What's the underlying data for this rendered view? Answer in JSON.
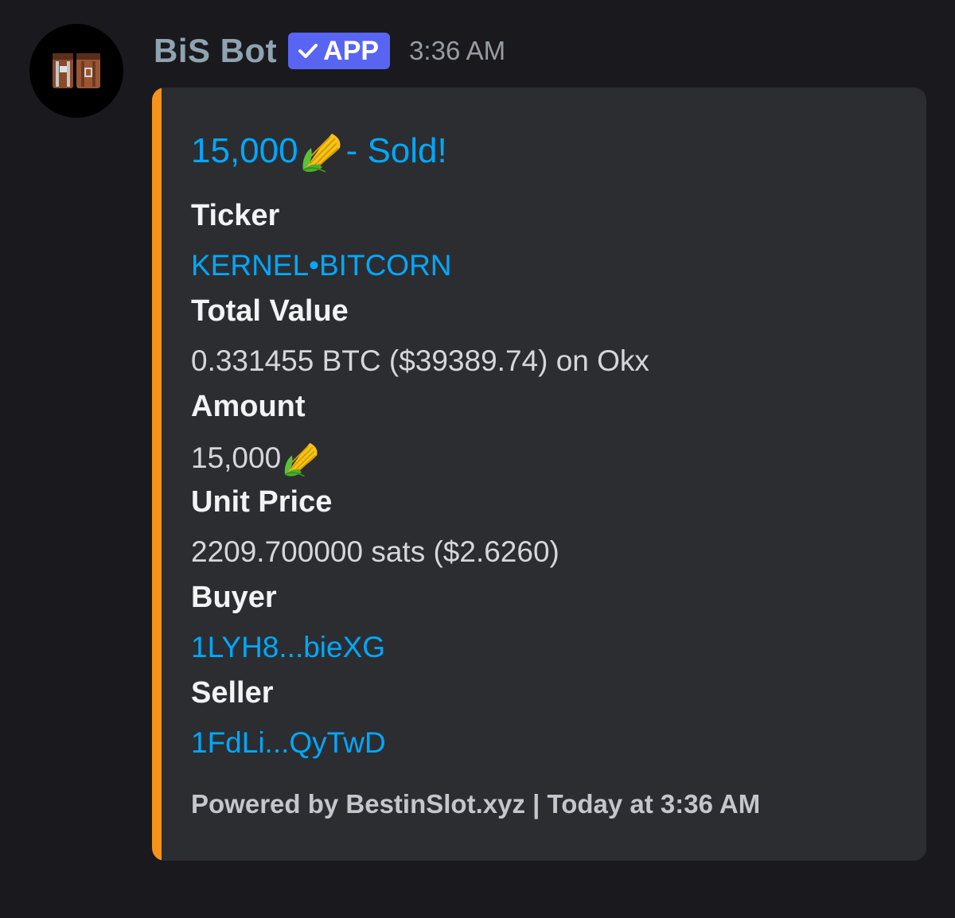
{
  "author": {
    "username": "BiS Bot",
    "badge": "APP",
    "timestamp": "3:36 AM",
    "avatar_icon": "treasure-chest-icon"
  },
  "colors": {
    "accent_bar": "#f7931a",
    "link": "#00a8fc",
    "badge_bg": "#5865f2",
    "embed_bg": "#2b2d31",
    "page_bg": "#1a1a1e"
  },
  "embed": {
    "title_amount": "15,000",
    "title_suffix": " - Sold!",
    "title_icon": "corn-emoji",
    "fields": {
      "ticker": {
        "name": "Ticker",
        "value": "KERNEL•BITCORN"
      },
      "total_value": {
        "name": "Total Value",
        "value": "0.331455 BTC ($39389.74) on Okx"
      },
      "amount": {
        "name": "Amount",
        "value": "15,000",
        "icon": "corn-emoji"
      },
      "unit_price": {
        "name": "Unit Price",
        "value": "2209.700000 sats ($2.6260)"
      },
      "buyer": {
        "name": "Buyer",
        "value": "1LYH8...bieXG"
      },
      "seller": {
        "name": "Seller",
        "value": "1FdLi...QyTwD"
      }
    },
    "footer": "Powered by BestinSlot.xyz | Today at 3:36 AM"
  }
}
